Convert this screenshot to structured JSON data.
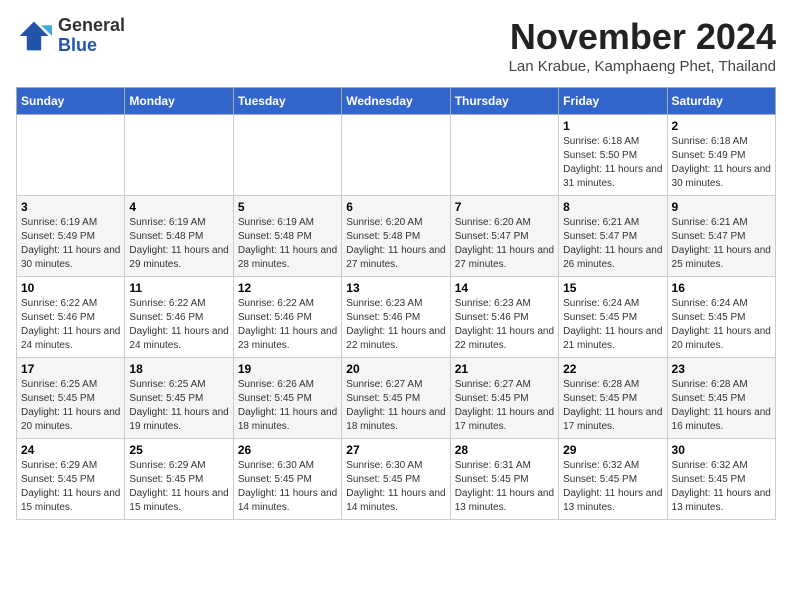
{
  "header": {
    "logo_general": "General",
    "logo_blue": "Blue",
    "month_title": "November 2024",
    "location": "Lan Krabue, Kamphaeng Phet, Thailand"
  },
  "weekdays": [
    "Sunday",
    "Monday",
    "Tuesday",
    "Wednesday",
    "Thursday",
    "Friday",
    "Saturday"
  ],
  "weeks": [
    [
      {
        "day": "",
        "info": ""
      },
      {
        "day": "",
        "info": ""
      },
      {
        "day": "",
        "info": ""
      },
      {
        "day": "",
        "info": ""
      },
      {
        "day": "",
        "info": ""
      },
      {
        "day": "1",
        "info": "Sunrise: 6:18 AM\nSunset: 5:50 PM\nDaylight: 11 hours and 31 minutes."
      },
      {
        "day": "2",
        "info": "Sunrise: 6:18 AM\nSunset: 5:49 PM\nDaylight: 11 hours and 30 minutes."
      }
    ],
    [
      {
        "day": "3",
        "info": "Sunrise: 6:19 AM\nSunset: 5:49 PM\nDaylight: 11 hours and 30 minutes."
      },
      {
        "day": "4",
        "info": "Sunrise: 6:19 AM\nSunset: 5:48 PM\nDaylight: 11 hours and 29 minutes."
      },
      {
        "day": "5",
        "info": "Sunrise: 6:19 AM\nSunset: 5:48 PM\nDaylight: 11 hours and 28 minutes."
      },
      {
        "day": "6",
        "info": "Sunrise: 6:20 AM\nSunset: 5:48 PM\nDaylight: 11 hours and 27 minutes."
      },
      {
        "day": "7",
        "info": "Sunrise: 6:20 AM\nSunset: 5:47 PM\nDaylight: 11 hours and 27 minutes."
      },
      {
        "day": "8",
        "info": "Sunrise: 6:21 AM\nSunset: 5:47 PM\nDaylight: 11 hours and 26 minutes."
      },
      {
        "day": "9",
        "info": "Sunrise: 6:21 AM\nSunset: 5:47 PM\nDaylight: 11 hours and 25 minutes."
      }
    ],
    [
      {
        "day": "10",
        "info": "Sunrise: 6:22 AM\nSunset: 5:46 PM\nDaylight: 11 hours and 24 minutes."
      },
      {
        "day": "11",
        "info": "Sunrise: 6:22 AM\nSunset: 5:46 PM\nDaylight: 11 hours and 24 minutes."
      },
      {
        "day": "12",
        "info": "Sunrise: 6:22 AM\nSunset: 5:46 PM\nDaylight: 11 hours and 23 minutes."
      },
      {
        "day": "13",
        "info": "Sunrise: 6:23 AM\nSunset: 5:46 PM\nDaylight: 11 hours and 22 minutes."
      },
      {
        "day": "14",
        "info": "Sunrise: 6:23 AM\nSunset: 5:46 PM\nDaylight: 11 hours and 22 minutes."
      },
      {
        "day": "15",
        "info": "Sunrise: 6:24 AM\nSunset: 5:45 PM\nDaylight: 11 hours and 21 minutes."
      },
      {
        "day": "16",
        "info": "Sunrise: 6:24 AM\nSunset: 5:45 PM\nDaylight: 11 hours and 20 minutes."
      }
    ],
    [
      {
        "day": "17",
        "info": "Sunrise: 6:25 AM\nSunset: 5:45 PM\nDaylight: 11 hours and 20 minutes."
      },
      {
        "day": "18",
        "info": "Sunrise: 6:25 AM\nSunset: 5:45 PM\nDaylight: 11 hours and 19 minutes."
      },
      {
        "day": "19",
        "info": "Sunrise: 6:26 AM\nSunset: 5:45 PM\nDaylight: 11 hours and 18 minutes."
      },
      {
        "day": "20",
        "info": "Sunrise: 6:27 AM\nSunset: 5:45 PM\nDaylight: 11 hours and 18 minutes."
      },
      {
        "day": "21",
        "info": "Sunrise: 6:27 AM\nSunset: 5:45 PM\nDaylight: 11 hours and 17 minutes."
      },
      {
        "day": "22",
        "info": "Sunrise: 6:28 AM\nSunset: 5:45 PM\nDaylight: 11 hours and 17 minutes."
      },
      {
        "day": "23",
        "info": "Sunrise: 6:28 AM\nSunset: 5:45 PM\nDaylight: 11 hours and 16 minutes."
      }
    ],
    [
      {
        "day": "24",
        "info": "Sunrise: 6:29 AM\nSunset: 5:45 PM\nDaylight: 11 hours and 15 minutes."
      },
      {
        "day": "25",
        "info": "Sunrise: 6:29 AM\nSunset: 5:45 PM\nDaylight: 11 hours and 15 minutes."
      },
      {
        "day": "26",
        "info": "Sunrise: 6:30 AM\nSunset: 5:45 PM\nDaylight: 11 hours and 14 minutes."
      },
      {
        "day": "27",
        "info": "Sunrise: 6:30 AM\nSunset: 5:45 PM\nDaylight: 11 hours and 14 minutes."
      },
      {
        "day": "28",
        "info": "Sunrise: 6:31 AM\nSunset: 5:45 PM\nDaylight: 11 hours and 13 minutes."
      },
      {
        "day": "29",
        "info": "Sunrise: 6:32 AM\nSunset: 5:45 PM\nDaylight: 11 hours and 13 minutes."
      },
      {
        "day": "30",
        "info": "Sunrise: 6:32 AM\nSunset: 5:45 PM\nDaylight: 11 hours and 13 minutes."
      }
    ]
  ]
}
